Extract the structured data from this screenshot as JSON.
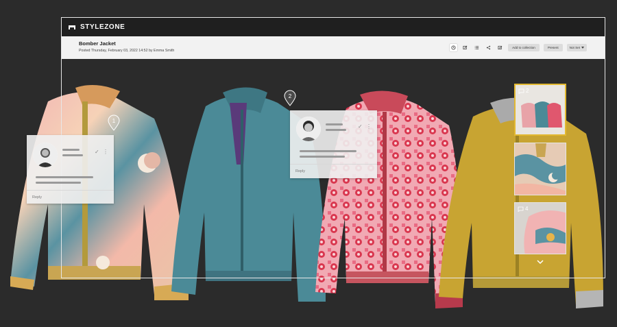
{
  "app": {
    "brand": "STYLEZONE"
  },
  "post": {
    "title": "Bomber Jacket",
    "meta": "Posted Thursday, February 03, 2022 14:52 by Emma Smith"
  },
  "toolbar": {
    "add_to_collection": "Add to collection",
    "present": "Present",
    "status_select": "Not Set"
  },
  "comments": [
    {
      "pin": "1",
      "reply": "Reply"
    },
    {
      "pin": "2",
      "reply": "Reply"
    }
  ],
  "thumbnails": [
    {
      "count": "2",
      "selected": true
    },
    {
      "count": "",
      "selected": false
    },
    {
      "count": "4",
      "selected": false
    }
  ],
  "colors": {
    "frame": "#e8e8e8",
    "topbar": "#1f1f1f",
    "selected_thumb": "#e2b830",
    "background": "#2b2b2b"
  }
}
